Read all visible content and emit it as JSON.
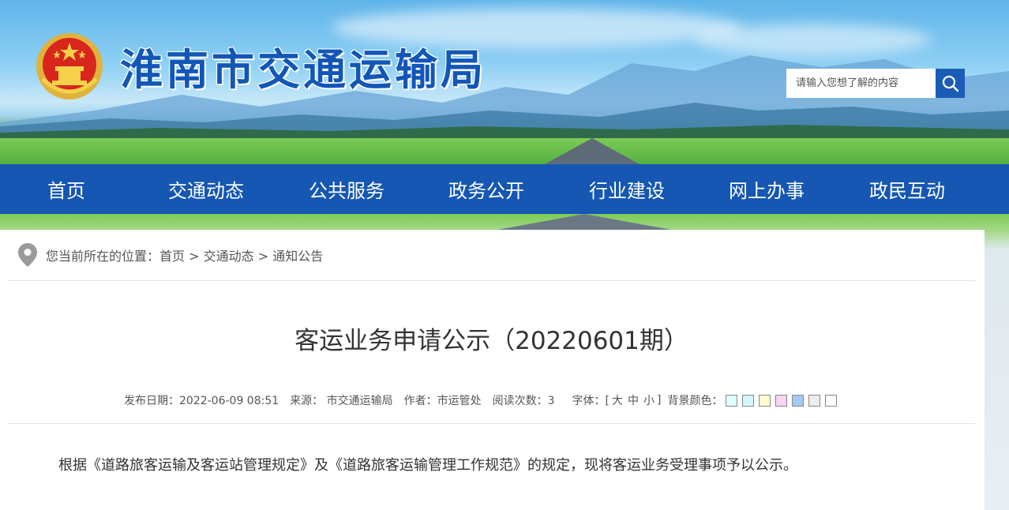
{
  "header": {
    "site_title": "淮南市交通运输局",
    "emblem_icon": "national-emblem-icon",
    "search": {
      "placeholder": "请输入您想了解的内容",
      "icon": "search-icon"
    }
  },
  "nav": {
    "items": [
      {
        "label": "首页"
      },
      {
        "label": "交通动态"
      },
      {
        "label": "公共服务"
      },
      {
        "label": "政务公开"
      },
      {
        "label": "行业建设"
      },
      {
        "label": "网上办事"
      },
      {
        "label": "政民互动"
      }
    ]
  },
  "breadcrumb": {
    "icon": "location-pin-icon",
    "prefix": "您当前所在的位置：",
    "items": [
      "首页",
      "交通动态",
      "通知公告"
    ],
    "separator": " > "
  },
  "article": {
    "title": "客运业务申请公示（20220601期）",
    "meta": {
      "date": "发布日期：2022-06-09 08:51",
      "source": "来源：  市交通运输局",
      "author": "作者：市运管处",
      "views": "阅读次数：3",
      "font_label": "字体：[",
      "font_large": "大",
      "font_medium": "中",
      "font_small": "小",
      "font_close": "]",
      "bg_label": "背景颜色："
    },
    "bg_colors": [
      "#e0ffff",
      "#d4f6fa",
      "#fdfccf",
      "#fbd3f4",
      "#a4c9f4",
      "#ededed",
      "#ffffff"
    ],
    "paragraph": "根据《道路旅客运输及客运站管理规定》及《道路旅客运输管理工作规范》的规定，现将客运业务受理事项予以公示。"
  }
}
